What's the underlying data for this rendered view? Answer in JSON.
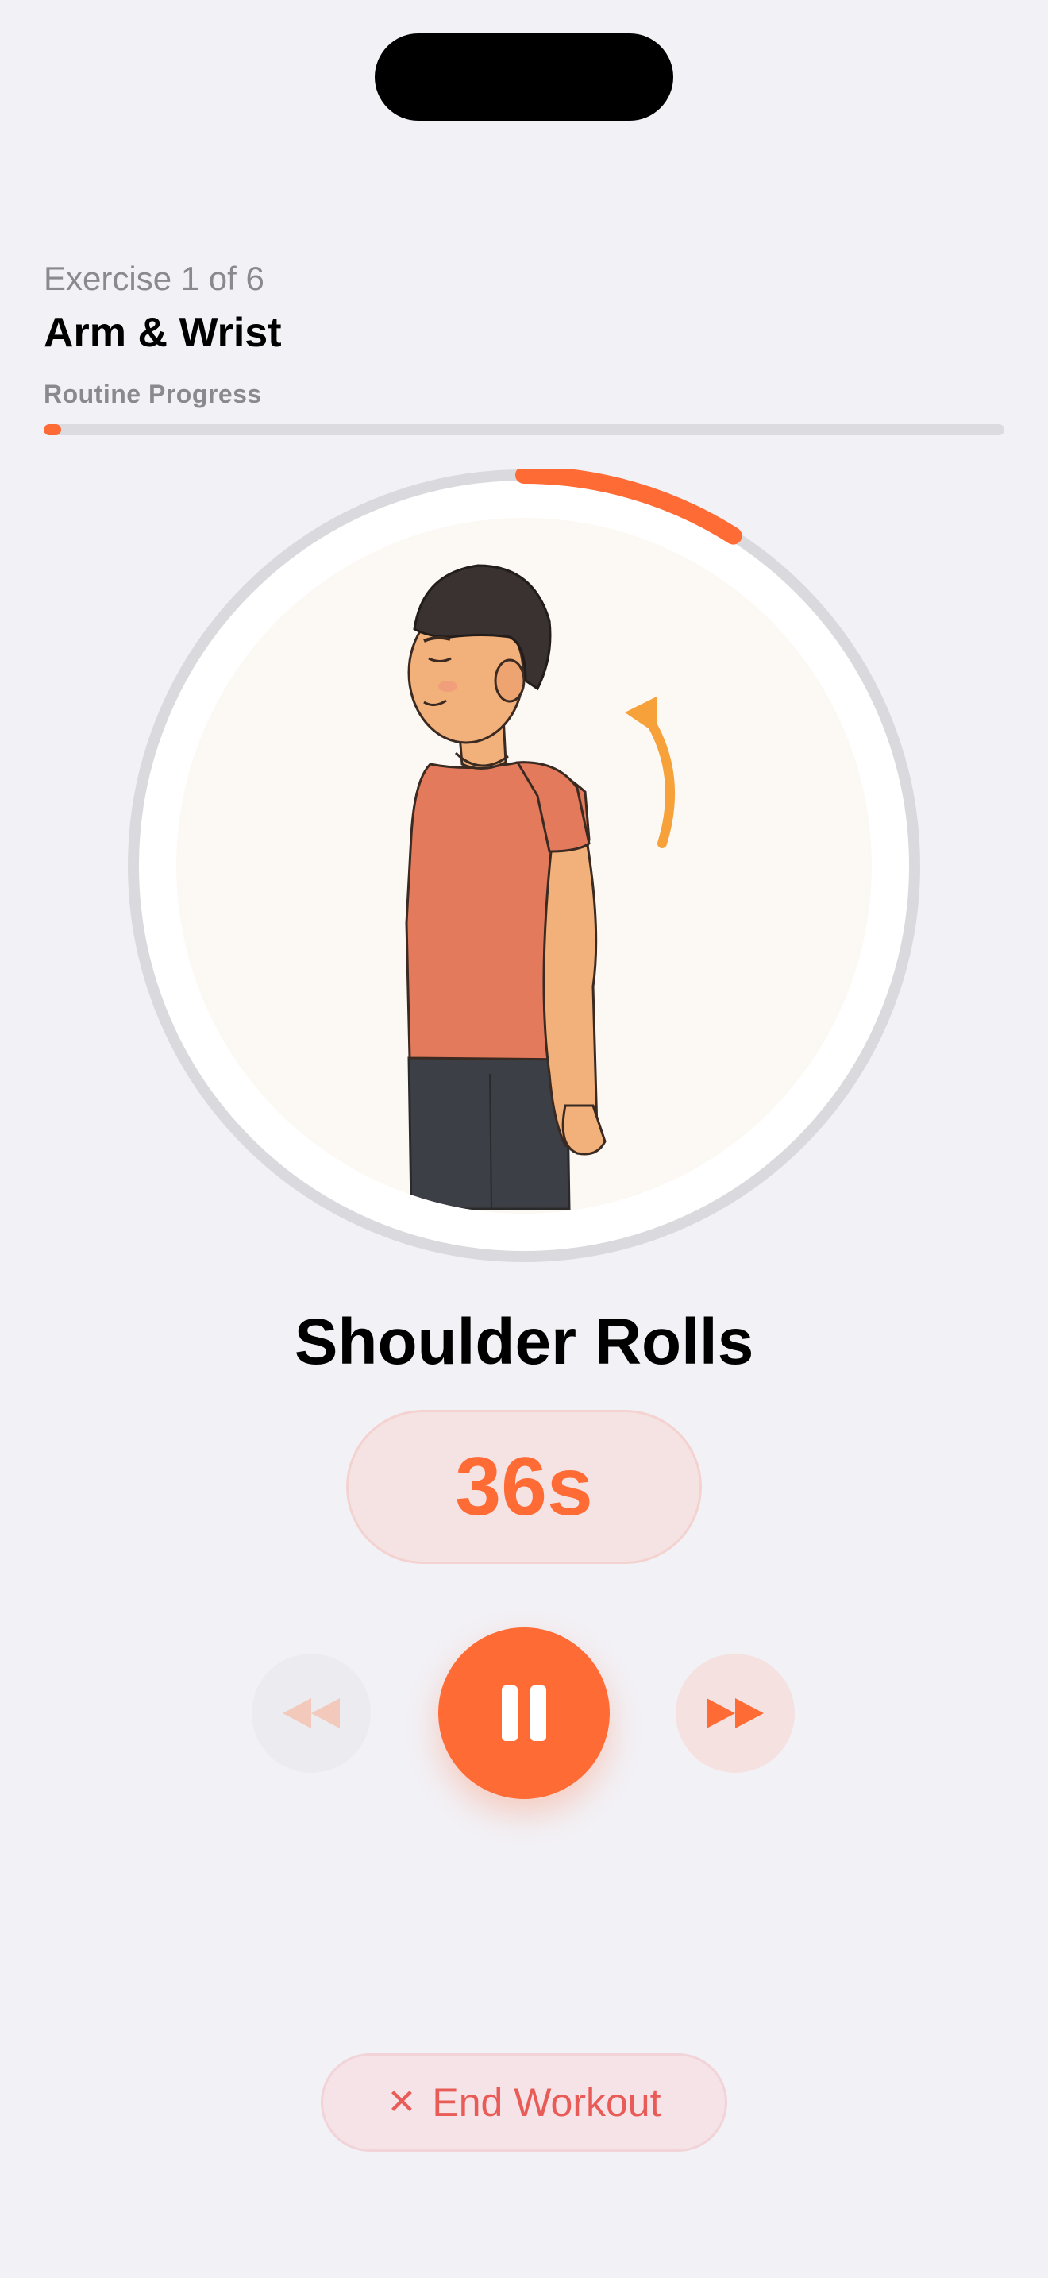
{
  "header": {
    "exercise_count": "Exercise 1 of 6",
    "routine_name": "Arm & Wrist",
    "progress_label": "Routine Progress",
    "routine_progress": 0.018
  },
  "exercise": {
    "name": "Shoulder Rolls",
    "time_remaining": "36s",
    "timer_progress": 0.09,
    "illustration": "person-shoulder-roll-illustration"
  },
  "controls": {
    "previous_icon": "backward-icon",
    "pause_icon": "pause-icon",
    "next_icon": "forward-icon"
  },
  "end_workout": {
    "label": "End Workout",
    "icon": "close-icon"
  },
  "colors": {
    "accent": "#ff6b35",
    "background": "#f2f1f6",
    "end_text": "#e95b56"
  }
}
